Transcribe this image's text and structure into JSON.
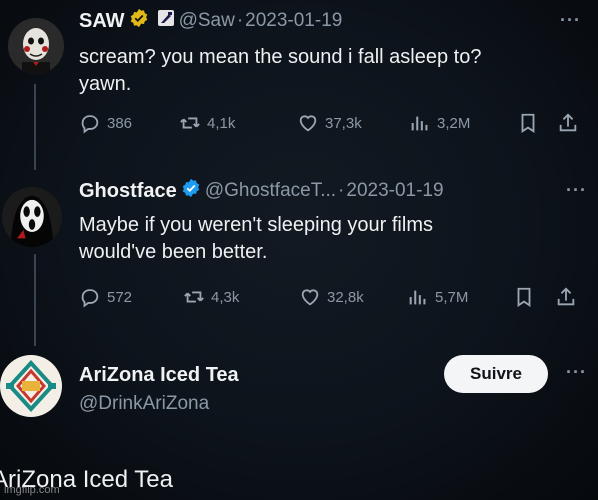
{
  "tweets": [
    {
      "name": "SAW",
      "handle": "@Saw",
      "separator": "·",
      "date": "2023-01-19",
      "more": "···",
      "text_line1": "scream? you mean the sound i fall asleep to?",
      "text_line2": "yawn.",
      "replies": "386",
      "retweets": "4,1k",
      "likes": "37,3k",
      "views": "3,2M",
      "badge_color": "#e2b719"
    },
    {
      "name": "Ghostface",
      "handle": "@GhostfaceT...",
      "separator": "·",
      "date": "2023-01-19",
      "more": "···",
      "text_line1": "Maybe if you weren't sleeping your films",
      "text_line2": "would've been better.",
      "replies": "572",
      "retweets": "4,3k",
      "likes": "32,8k",
      "views": "5,7M",
      "badge_color": "#1d9bf0"
    }
  ],
  "account": {
    "name": "AriZona Iced Tea",
    "handle": "@DrinkAriZona",
    "follow_label": "Suivre",
    "more": "···"
  },
  "footer_text": "AriZona Iced Tea",
  "watermark": "imgflip.com",
  "icons": {
    "reply": "reply-icon",
    "retweet": "retweet-icon",
    "like": "heart-icon",
    "views": "views-icon",
    "bookmark": "bookmark-icon",
    "share": "share-icon"
  },
  "colors": {
    "background": "#0d131b",
    "secondary_text": "#8b98a5",
    "verified_blue": "#1d9bf0",
    "verified_gold": "#e2b719"
  }
}
